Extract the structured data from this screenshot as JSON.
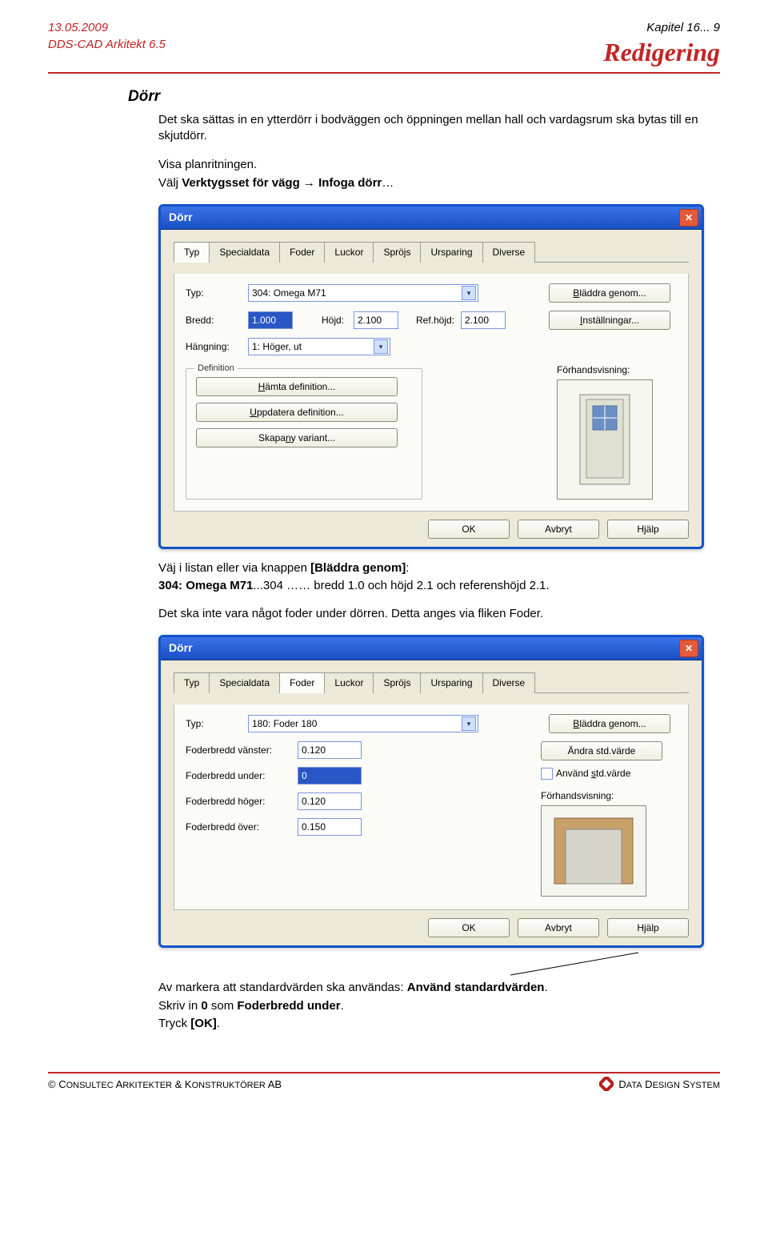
{
  "header": {
    "date": "13.05.2009",
    "product": "DDS-CAD Arkitekt 6.5",
    "chapter": "Kapitel 16... 9",
    "title": "Redigering"
  },
  "section": {
    "heading": "Dörr",
    "p1": "Det ska sättas in en ytterdörr i bodväggen och öppningen mellan hall och vardagsrum ska bytas till en skjutdörr.",
    "p2": "Visa planritningen.",
    "p3_pre": "Välj ",
    "p3_b": "Verktygsset för vägg",
    "p3_mid": " → ",
    "p3_b2": "Infoga dörr",
    "p3_post": "…",
    "mid1_pre": "Väj i listan eller via knappen ",
    "mid1_b": "[Bläddra genom]",
    "mid1_post": ":",
    "mid2_b": "304: Omega M71",
    "mid2_rest": "...304 …… bredd 1.0 och höjd 2.1 och referenshöjd 2.1.",
    "mid3": "Det ska inte vara något foder under dörren. Detta anges via fliken Foder.",
    "end1_pre": "Av markera att standardvärden ska användas: ",
    "end1_b": "Använd standardvärden",
    "end1_post": ".",
    "end2_pre": "Skriv in ",
    "end2_b": "0",
    "end2_mid": " som ",
    "end2_b2": "Foderbredd under",
    "end2_post": ".",
    "end3_pre": "Tryck ",
    "end3_b": "[OK]",
    "end3_post": "."
  },
  "dlg1": {
    "title": "Dörr",
    "tabs": {
      "typ": "Typ",
      "spec": "Specialdata",
      "foder": "Foder",
      "luckor": "Luckor",
      "sprojs": "Spröjs",
      "ursp": "Ursparing",
      "div": "Diverse"
    },
    "lbl_typ": "Typ:",
    "typ_val": "304: Omega M71",
    "lbl_bredd": "Bredd:",
    "bredd_val": "1.000",
    "lbl_hojd": "Höjd:",
    "hojd_val": "2.100",
    "lbl_refh": "Ref.höjd:",
    "refh_val": "2.100",
    "lbl_hang": "Hängning:",
    "hang_val": "1: Höger, ut",
    "btn_bladdra": "Bläddra genom...",
    "btn_inst": "Inställningar...",
    "preview_label": "Förhandsvisning:",
    "grp": "Definition",
    "grp_b1": "Hämta definition...",
    "grp_b2": "Uppdatera definition...",
    "grp_b3": "Skapa ny variant...",
    "ok": "OK",
    "cancel": "Avbryt",
    "help": "Hjälp"
  },
  "dlg2": {
    "title": "Dörr",
    "tabs": {
      "typ": "Typ",
      "spec": "Specialdata",
      "foder": "Foder",
      "luckor": "Luckor",
      "sprojs": "Spröjs",
      "ursp": "Ursparing",
      "div": "Diverse"
    },
    "lbl_typ": "Typ:",
    "typ_val": "180: Foder 180",
    "lbl_fv": "Foderbredd vänster:",
    "fv_val": "0.120",
    "lbl_fu": "Foderbredd under:",
    "fu_val": "0",
    "lbl_fh": "Foderbredd höger:",
    "fh_val": "0.120",
    "lbl_fo": "Foderbredd över:",
    "fo_val": "0.150",
    "btn_bladdra": "Bläddra genom...",
    "btn_andra": "Ändra std.värde",
    "chk": "Använd std.värde",
    "preview_label": "Förhandsvisning:",
    "ok": "OK",
    "cancel": "Avbryt",
    "help": "Hjälp"
  },
  "footer": {
    "left": "© Consultec Arkitekter & Konstruktörer AB",
    "right": "Data Design System"
  }
}
